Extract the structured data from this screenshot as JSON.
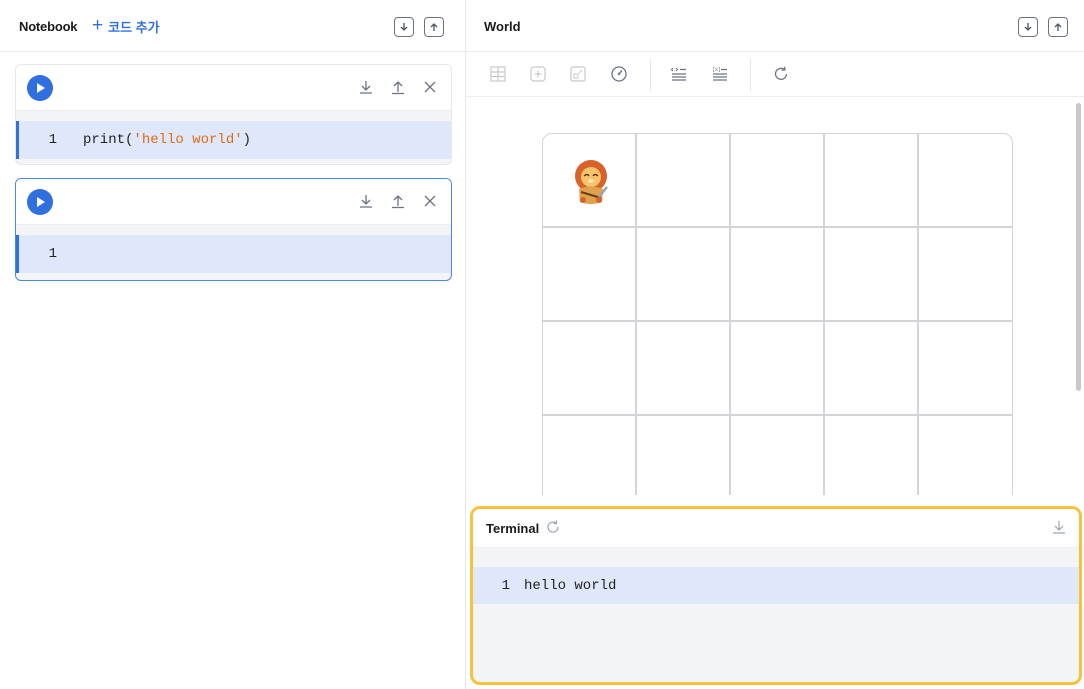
{
  "notebook": {
    "title": "Notebook",
    "add_code_label": "코드 추가",
    "cells": [
      {
        "line_number": "1",
        "code_func": "print(",
        "code_str": "'hello world'",
        "code_close": ")"
      },
      {
        "line_number": "1",
        "code_func": "",
        "code_str": "",
        "code_close": ""
      }
    ]
  },
  "world": {
    "title": "World",
    "toolbar_icons": [
      "grid-icon",
      "plus-icon",
      "zoom-icon",
      "speed-icon",
      "code-list-icon",
      "numbered-list-icon",
      "refresh-icon"
    ],
    "grid": {
      "columns": 5,
      "rows": 5,
      "character_position": {
        "col": 1,
        "row": 1
      }
    }
  },
  "terminal": {
    "title": "Terminal",
    "lines": [
      {
        "line_number": "1",
        "text": "hello world"
      }
    ]
  },
  "colors": {
    "accent": "#2f6fdf",
    "highlight": "#dfe8fb",
    "terminal_border": "#f5c23a",
    "string": "#e56910"
  }
}
